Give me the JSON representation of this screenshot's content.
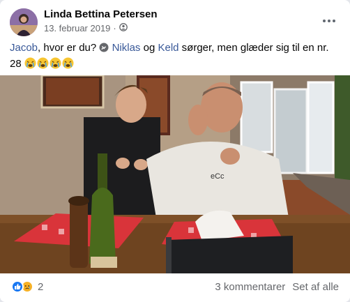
{
  "post": {
    "author": "Linda Bettina Petersen",
    "date": "13. februar 2019",
    "separator": "·",
    "privacy_icon": "friends-icon",
    "text": {
      "tag1": "Jacob",
      "part1": ", hvor er du? ",
      "tag2": "Niklas",
      "part2": " og ",
      "tag3": "Keld",
      "part3": " sørger, men glæder sig til en nr. 28 "
    }
  },
  "footer": {
    "reaction_icons": [
      "like-icon",
      "sad-icon"
    ],
    "reaction_count": "2",
    "comments_label": "3 kommentarer",
    "seen_label": "Set af alle"
  },
  "colors": {
    "link": "#385898",
    "muted": "#65676b",
    "like_blue": "#1877f2",
    "sad_yellow": "#f7b125"
  }
}
